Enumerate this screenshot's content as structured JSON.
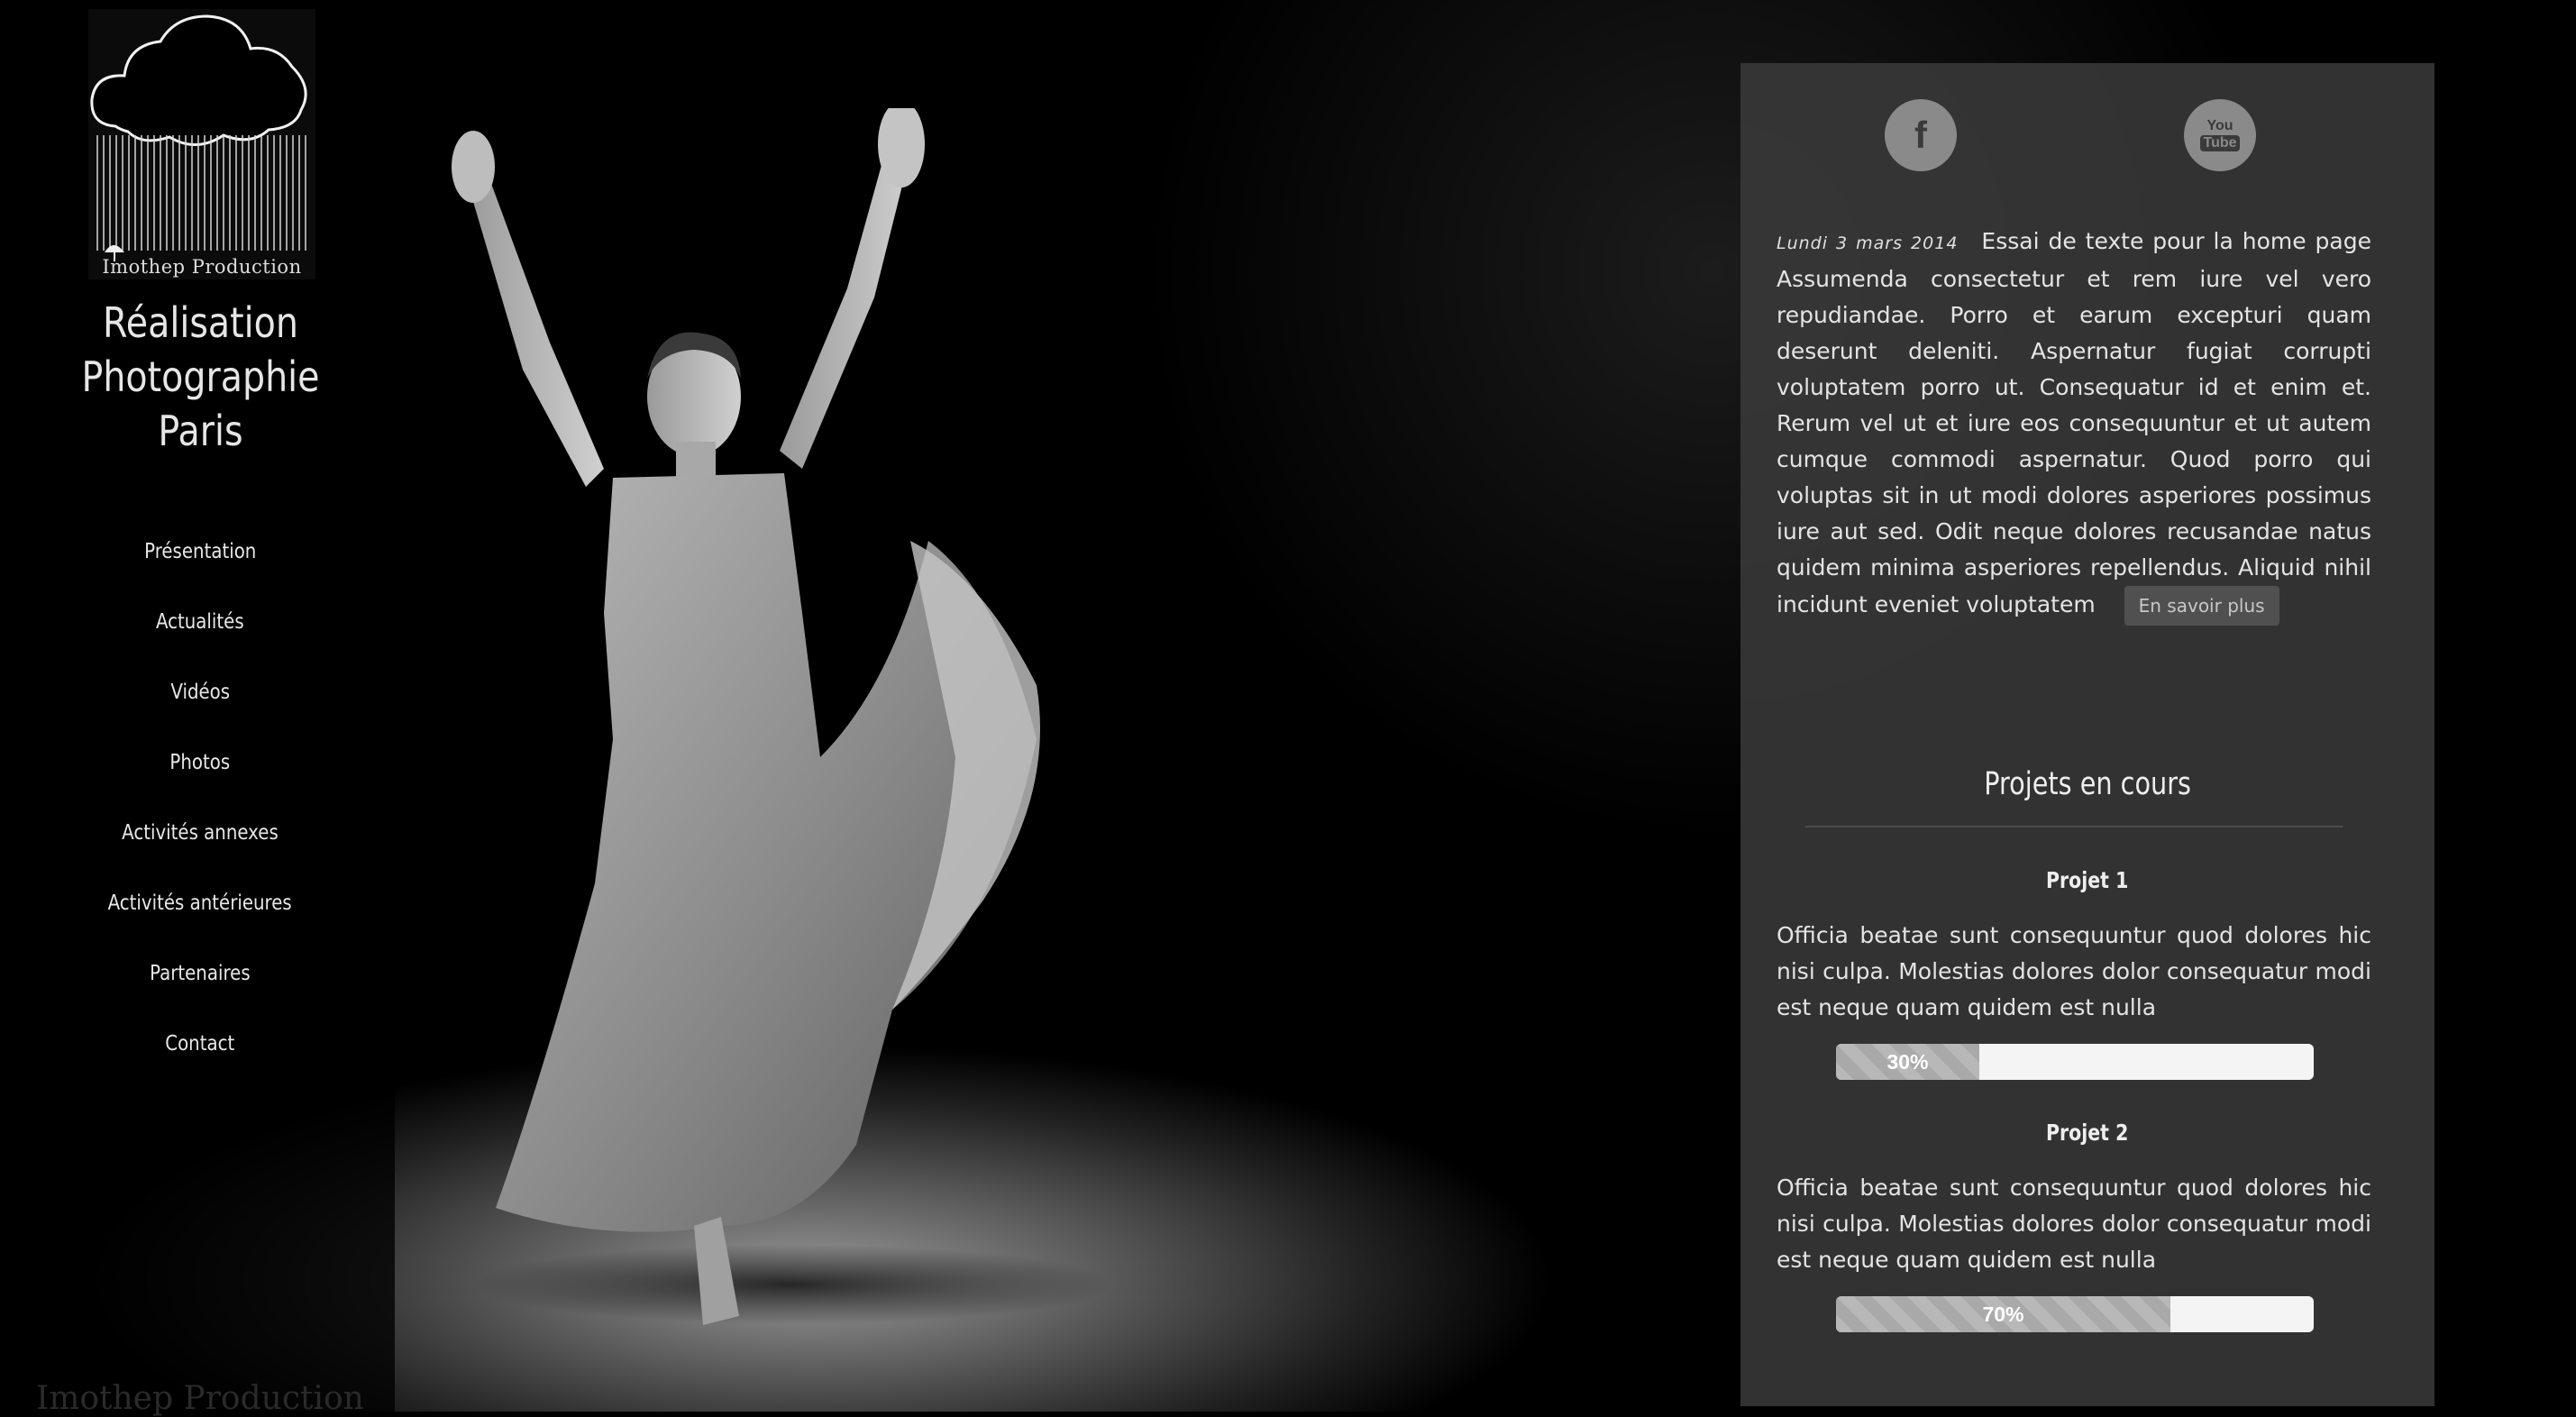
{
  "logo": {
    "caption": "Imothep Production"
  },
  "site_title": {
    "line1": "Réalisation",
    "line2": "Photographie",
    "line3": "Paris"
  },
  "menu": {
    "items": [
      {
        "label": "Présentation"
      },
      {
        "label": "Actualités"
      },
      {
        "label": "Vidéos"
      },
      {
        "label": "Photos"
      },
      {
        "label": "Activités annexes"
      },
      {
        "label": "Activités antérieures"
      },
      {
        "label": "Partenaires"
      },
      {
        "label": "Contact"
      }
    ]
  },
  "watermark": "Imothep Production",
  "social": {
    "facebook": {
      "icon": "facebook-icon",
      "glyph": "f"
    },
    "youtube": {
      "icon": "youtube-icon",
      "line1": "You",
      "line2": "Tube"
    }
  },
  "article": {
    "date": "Lundi 3 mars 2014",
    "title": "Essai de texte pour la home page",
    "body": "Assumenda consectetur et rem iure vel vero repudiandae. Porro et earum excepturi quam deserunt deleniti. Aspernatur fugiat corrupti voluptatem porro ut. Consequatur id et enim et. Rerum vel ut et iure eos consequuntur et ut autem cumque commodi aspernatur. Quod porro qui voluptas sit in ut modi dolores asperiores possimus iure aut sed. Odit neque dolores recusandae natus quidem minima asperiores repellendus. Aliquid nihil incidunt eveniet voluptatem",
    "more_label": "En savoir plus"
  },
  "projects": {
    "title": "Projets en cours",
    "items": [
      {
        "name": "Projet 1",
        "text": "Officia beatae sunt consequuntur quod dolores hic nisi culpa. Molestias dolores dolor consequatur modi est neque quam quidem est nulla",
        "progress": 0.3,
        "progress_label": "30%"
      },
      {
        "name": "Projet 2",
        "text": "Officia beatae sunt consequuntur quod dolores hic nisi culpa. Molestias dolores dolor consequatur modi est neque quam quidem est nulla",
        "progress": 0.7,
        "progress_label": "70%"
      }
    ]
  }
}
